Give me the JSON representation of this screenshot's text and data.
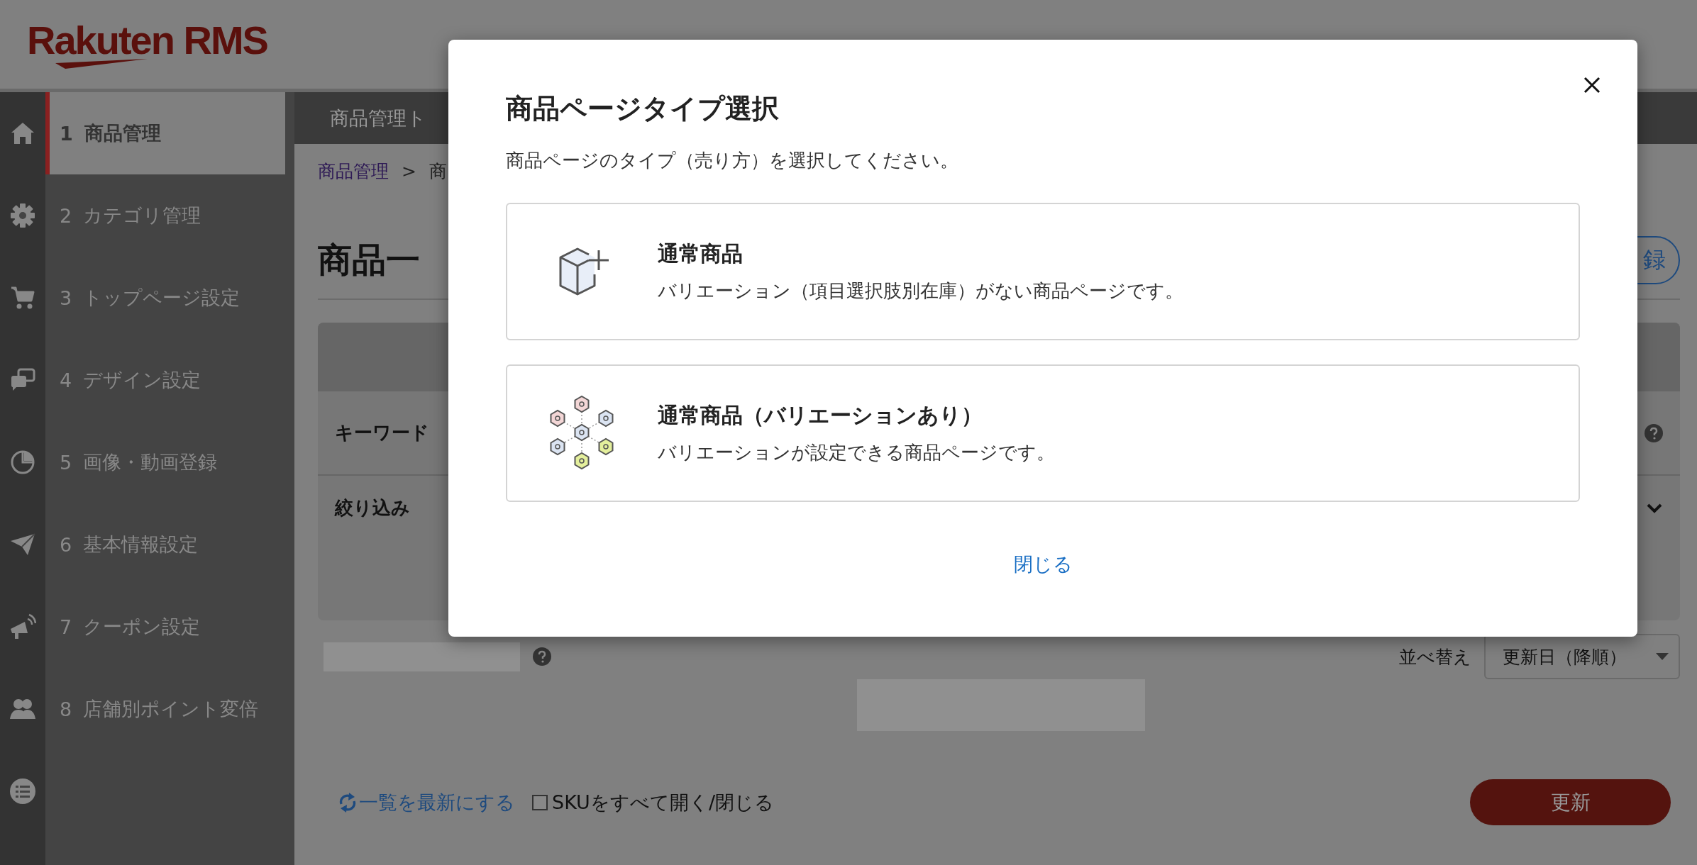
{
  "header": {
    "logo": "Rakuten RMS"
  },
  "sidebar": {
    "items": [
      {
        "number": "1",
        "label": "商品管理",
        "selected": true
      },
      {
        "number": "2",
        "label": "カテゴリ管理",
        "selected": false
      },
      {
        "number": "3",
        "label": "トップページ設定",
        "selected": false
      },
      {
        "number": "4",
        "label": "デザイン設定",
        "selected": false
      },
      {
        "number": "5",
        "label": "画像・動画登録",
        "selected": false
      },
      {
        "number": "6",
        "label": "基本情報設定",
        "selected": false
      },
      {
        "number": "7",
        "label": "クーポン設定",
        "selected": false
      },
      {
        "number": "8",
        "label": "店舗別ポイント変倍",
        "selected": false
      }
    ]
  },
  "top_nav": {
    "tab": "商品管理ト"
  },
  "breadcrumb": [
    {
      "kind": "link",
      "label": "商品管理"
    },
    {
      "kind": "separator",
      "label": ">"
    },
    {
      "kind": "text",
      "label": "商"
    }
  ],
  "page_title": "商品一",
  "register_button": "録",
  "search_panel": {
    "keyword_label": "キーワード",
    "filter_label": "絞り込み"
  },
  "sort": {
    "label": "並べ替え",
    "value": "更新日（降順）"
  },
  "refresh_link": "一覧を最新にする",
  "sku_toggle": {
    "label": "SKUをすべて開く/閉じる",
    "checked": false
  },
  "update_button": "更新",
  "modal": {
    "title": "商品ページタイプ選択",
    "subtitle": "商品ページのタイプ（売り方）を選択してください。",
    "options": [
      {
        "kind": "single",
        "title": "通常商品",
        "description": "バリエーション（項目選択肢別在庫）がない商品ページです。"
      },
      {
        "kind": "variation",
        "title": "通常商品（バリエーションあり）",
        "description": "バリエーションが設定できる商品ページです。"
      }
    ],
    "close_link": "閉じる"
  }
}
